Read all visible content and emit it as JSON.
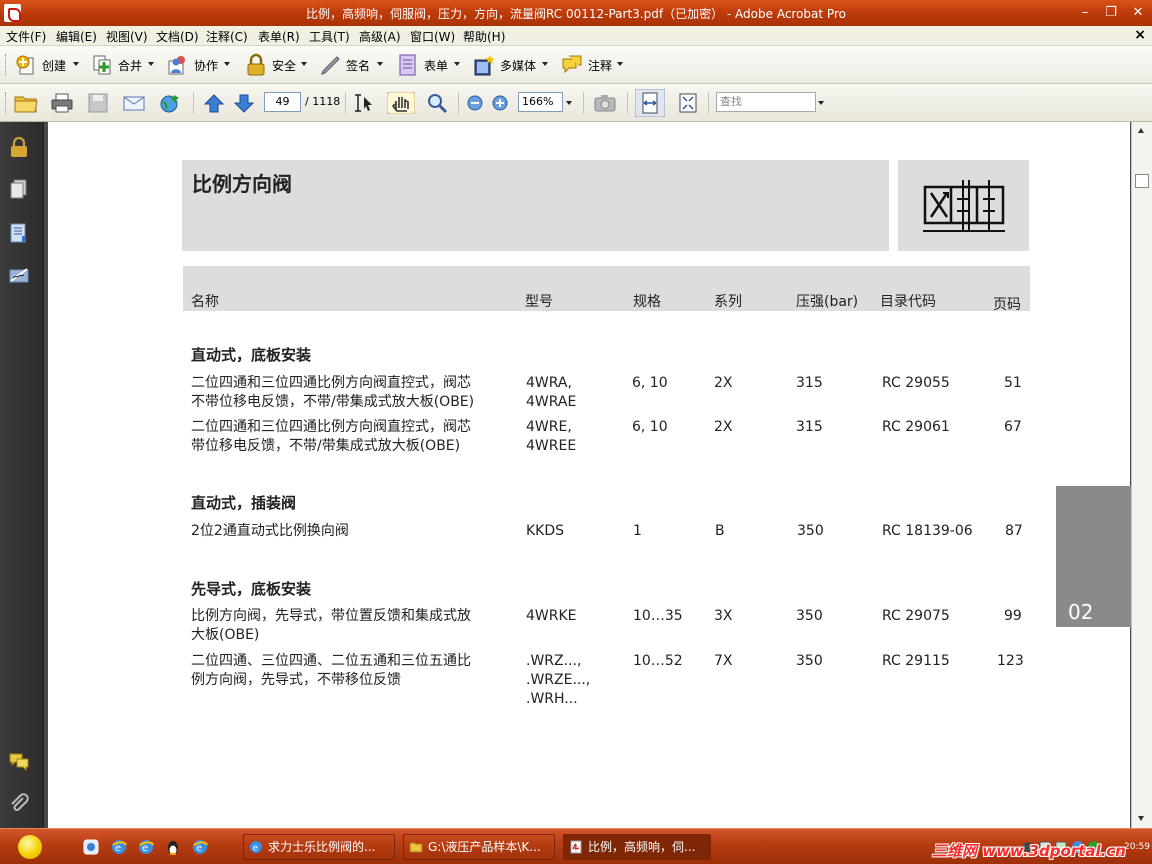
{
  "window": {
    "title": "比例，高频响，伺服阀，压力，方向，流量阀RC 00112-Part3.pdf（已加密） - Adobe Acrobat Pro",
    "minimize": "–",
    "restore": "❐",
    "close": "✕",
    "doc_close": "×"
  },
  "menu": [
    "文件(F)",
    "编辑(E)",
    "视图(V)",
    "文档(D)",
    "注释(C)",
    "表单(R)",
    "工具(T)",
    "高级(A)",
    "窗口(W)",
    "帮助(H)"
  ],
  "tasks": [
    {
      "label": "创建",
      "icon": "create-icon"
    },
    {
      "label": "合并",
      "icon": "combine-icon"
    },
    {
      "label": "协作",
      "icon": "collaborate-icon"
    },
    {
      "label": "安全",
      "icon": "lock-icon"
    },
    {
      "label": "签名",
      "icon": "pen-icon"
    },
    {
      "label": "表单",
      "icon": "form-icon"
    },
    {
      "label": "多媒体",
      "icon": "multimedia-icon"
    },
    {
      "label": "注释",
      "icon": "comment-icon"
    }
  ],
  "nav": {
    "page_current": "49",
    "page_total": "/ 1118",
    "zoom": "166%",
    "find_placeholder": "查找"
  },
  "document": {
    "title": "比例方向阀",
    "columns": [
      "名称",
      "型号",
      "规格",
      "系列",
      "压强(bar)",
      "目录代码",
      "页码"
    ],
    "sections": [
      {
        "heading": "直动式，底板安装",
        "rows": [
          {
            "name": [
              "二位四通和三位四通比例方向阀直控式，阀芯",
              "不带位移电反馈，不带/带集成式放大板(OBE)"
            ],
            "model": [
              "4WRA,",
              "4WRAE"
            ],
            "size": "6, 10",
            "series": "2X",
            "pressure": "315",
            "code": "RC 29055",
            "page": "51"
          },
          {
            "name": [
              "二位四通和三位四通比例方向阀直控式，阀芯",
              "带位移电反馈，不带/带集成式放大板(OBE)"
            ],
            "model": [
              "4WRE,",
              "4WREE"
            ],
            "size": "6, 10",
            "series": "2X",
            "pressure": "315",
            "code": "RC 29061",
            "page": "67"
          }
        ]
      },
      {
        "heading": "直动式，插装阀",
        "rows": [
          {
            "name": [
              "2位2通直动式比例换向阀"
            ],
            "model": [
              "KKDS"
            ],
            "size": "1",
            "series": "B",
            "pressure": "350",
            "code": "RC 18139-06",
            "page": "87"
          }
        ]
      },
      {
        "heading": "先导式，底板安装",
        "rows": [
          {
            "name": [
              "比例方向阀，先导式，带位置反馈和集成式放",
              "大板(OBE)"
            ],
            "model": [
              "4WRKE"
            ],
            "size": "10…35",
            "series": "3X",
            "pressure": "350",
            "code": "RC 29075",
            "page": "99"
          },
          {
            "name": [
              "二位四通、三位四通、二位五通和三位五通比",
              "例方向阀，先导式，不带移位反馈"
            ],
            "model": [
              ".WRZ...,",
              ".WRZE...,",
              ".WRH..."
            ],
            "size": "10…52",
            "series": "7X",
            "pressure": "350",
            "code": "RC 29115",
            "page": "123"
          }
        ]
      }
    ],
    "chapter": "02"
  },
  "taskbar": {
    "buttons": [
      {
        "label": "求力士乐比例阀的...",
        "icon": "ie-icon"
      },
      {
        "label": "G:\\液压产品样本\\K...",
        "icon": "folder-icon"
      },
      {
        "label": "比例，高频响，伺...",
        "icon": "pdf-icon"
      }
    ],
    "watermark": "三维网 www.3dportal.cn",
    "clock": "20:59"
  },
  "colors": {
    "titlebar": "#c03c0c",
    "taskbar": "#b83e14",
    "panel_grey": "#dddddd",
    "chapter_tab": "#8a8a8a"
  }
}
